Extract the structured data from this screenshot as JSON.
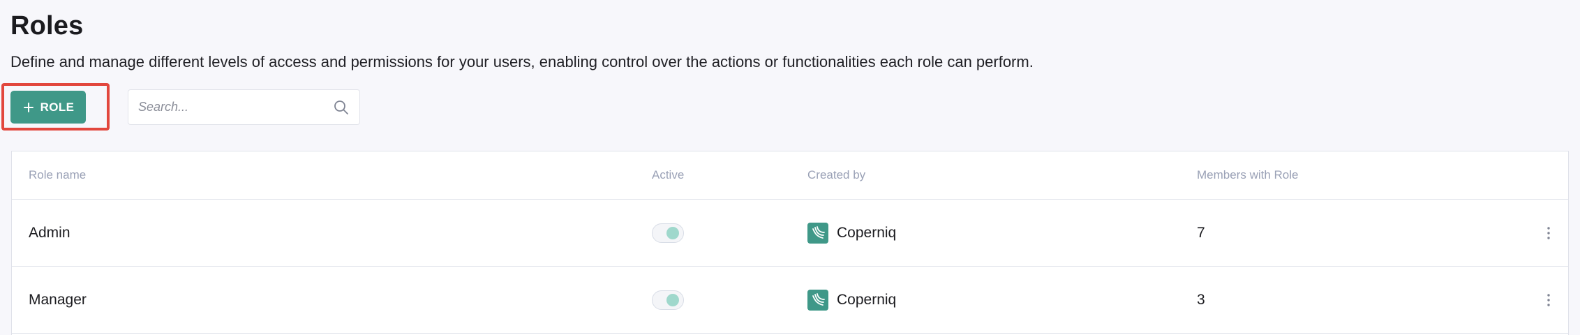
{
  "page": {
    "title": "Roles",
    "description": "Define and manage different levels of access and permissions for your users, enabling control over the actions or functionalities each role can perform."
  },
  "toolbar": {
    "add_role_label": "ROLE",
    "add_role_icon": "plus-icon",
    "search_placeholder": "Search...",
    "search_value": "",
    "search_icon": "search-icon"
  },
  "table": {
    "columns": [
      "Role name",
      "Active",
      "Created by",
      "Members with Role"
    ],
    "rows": [
      {
        "role_name": "Admin",
        "active": true,
        "created_by": "Coperniq",
        "members": "7"
      },
      {
        "role_name": "Manager",
        "active": true,
        "created_by": "Coperniq",
        "members": "3"
      }
    ]
  },
  "colors": {
    "accent": "#3f9888",
    "highlight": "#e2473d",
    "toggle_knob": "#9fd8cc"
  }
}
